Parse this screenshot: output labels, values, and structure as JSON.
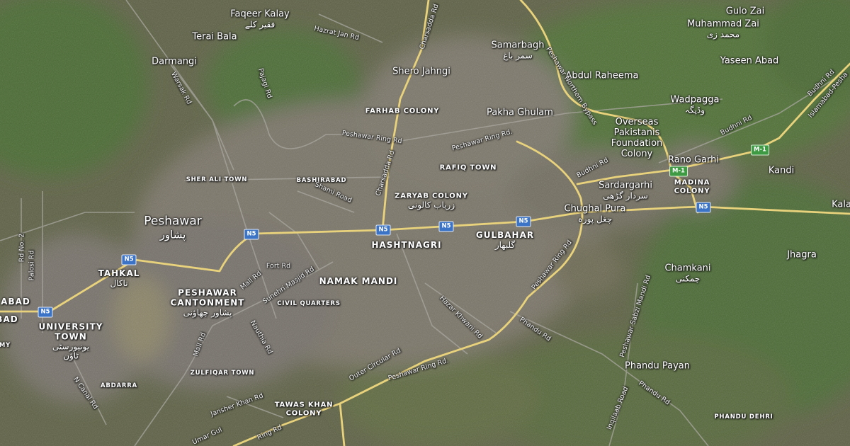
{
  "map": {
    "type": "satellite",
    "colors": {
      "urban": "#7d776a",
      "vegetation": "#4f6b35",
      "field_light": "#8e8a6b",
      "highway": "#e6d07a",
      "minor_road": "#a8a8a8",
      "shield_national": "#3b73c6",
      "shield_motorway": "#3f9a44"
    },
    "places": {
      "faqeer_kalay": {
        "name": "Faqeer Kalay",
        "urdu": "فقیر کلے"
      },
      "terai_bala": {
        "name": "Terai Bala"
      },
      "darmangi": {
        "name": "Darmangi"
      },
      "samarbagh": {
        "name": "Samarbagh",
        "urdu": "سمر باغ"
      },
      "shero_jahngi": {
        "name": "Shero Jahngi"
      },
      "gulo_zai": {
        "name": "Gulo Zai"
      },
      "muhammad_zai": {
        "name": "Muhammad Zai",
        "urdu": "محمد زی"
      },
      "yaseen_abad": {
        "name": "Yaseen Abad"
      },
      "abdul_raheema": {
        "name": "Abdul Raheema"
      },
      "wadpagga": {
        "name": "Wadpagga",
        "urdu": "وڈپگہ"
      },
      "pakha_ghulam": {
        "name": "Pakha Ghulam"
      },
      "overseas": {
        "line1": "Overseas",
        "line2": "Pakistanis",
        "line3": "Foundation",
        "line4": "Colony"
      },
      "rano_garhi": {
        "name": "Rano Garhi"
      },
      "kandi": {
        "name": "Kandi"
      },
      "sardargarhi": {
        "name": "Sardargarhi",
        "urdu": "سردار گڑھی"
      },
      "chughal_pura": {
        "name": "Chughal Pura",
        "urdu": "چغل پورہ"
      },
      "kala": {
        "name": "Kala"
      },
      "peshawar": {
        "name": "Peshawar",
        "urdu": "پشاور"
      },
      "jhagra": {
        "name": "Jhagra"
      },
      "chamkani": {
        "name": "Chamkani",
        "urdu": "چمکنی"
      },
      "phandu_payan": {
        "name": "Phandu Payan"
      }
    },
    "districts": {
      "farhab_colony": "FARHAB COLONY",
      "rafiq_town": "RAFIQ TOWN",
      "sher_ali_town": "SHER ALI TOWN",
      "bashirabad": "BASHIRABAD",
      "zaryab_colony": {
        "name": "ZARYAB COLONY",
        "urdu": "زریاب کالونی"
      },
      "madina_colony": {
        "line1": "MADINA",
        "line2": "COLONY"
      },
      "hashtnagri": "HASHTNAGRI",
      "gulbahar": {
        "name": "GULBAHAR",
        "urdu": "گلبھار"
      },
      "tahkal": {
        "name": "TAHKAL",
        "urdu": "تاکال"
      },
      "abad": "ABAD",
      "bad": "BAD",
      "university_town": {
        "line1": "UNIVERSITY",
        "line2": "TOWN",
        "urdu1": "یونیورسٹی",
        "urdu2": "ٹاؤن"
      },
      "peshawar_cantonment": {
        "line1": "PESHAWAR",
        "line2": "CANTONMENT",
        "urdu": "پشاور چھاؤنی"
      },
      "namak_mandi": "NAMAK MANDI",
      "civil_quarters": "CIVIL QUARTERS",
      "zulfiqar_town": "ZULFIQAR TOWN",
      "abdarra": "ABDARRA",
      "tawas_khan_colony": {
        "line1": "TAWAS KHAN",
        "line2": "COLONY"
      },
      "phandu_dehri": "PHANDU DEHRI",
      "my": "MY"
    },
    "roads": {
      "charsadda_rd_top": "Charsadda Rd",
      "hazrat_jan_rd": "Hazrat Jan Rd",
      "pajagi_rd": "Pajagi Rd",
      "warsak_rd": "Warsak Rd",
      "peshawar_northern_bypass": "Peshawar Northern Bypass",
      "peshawar_ring_rd_1": "Peshawar Ring Rd",
      "peshawar_ring_rd_2": "Peshawar Ring Rd.",
      "charsadda_rd": "Charsadda Rd",
      "shami_road": "Shami Road",
      "budhni_rd_1": "Budhni Rd",
      "budhni_rd_2": "Budhni Rd",
      "budhni_rd_3": "Budhni Rd",
      "islamabad_peshawar": "Islamabad-Pesha",
      "peshawar_ring_rd_3": "Peshawar Ring Rd",
      "fort_rd": "Fort Rd",
      "mall_rd_1": "Mall Rd",
      "sunehri_masjid_rd": "Sunehri Masjid Rd",
      "hazar_khwani_rd": "Hazar Khwani Rd",
      "rd_no_2": "Rd No. 2",
      "palosi_rd": "Palosi Rd",
      "nauthia_rd": "Nauthia Rd",
      "mall_rd_2": "Mall Rd",
      "outer_circular_rd": "Outer Circular Rd",
      "peshawar_ring_rd_4": "Peshawar Ring Rd.",
      "phandu_rd_1": "Phandu Rd",
      "peshawar_sabzi_mandi_rd": "Peshawar Sabzi Mandi Rd",
      "phandu_rd_2": "Phandu Rd",
      "inqilaab_road": "Inqilaab Road",
      "n_canal_rd": "N Canal Rd",
      "jansher_khan_rd": "Jansher Khan Rd",
      "ring_rd_bottom": "Ring Rd",
      "umar_gul": "Umar Gul"
    },
    "shields": {
      "n5": "N5",
      "m1": "M-1"
    }
  }
}
